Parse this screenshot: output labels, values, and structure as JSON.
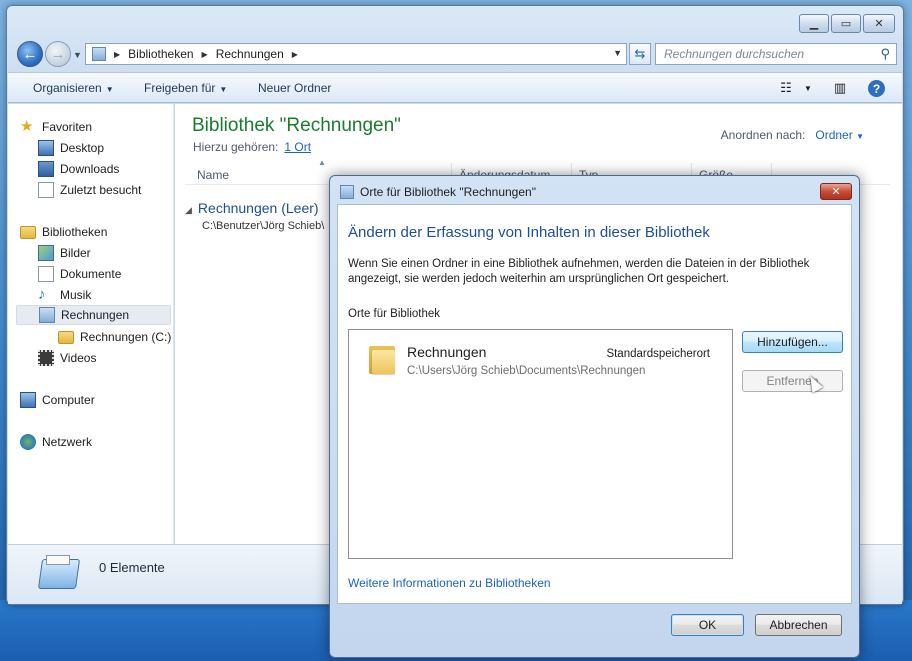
{
  "window": {
    "address": {
      "crumbs": [
        "Bibliotheken",
        "Rechnungen"
      ]
    },
    "search": {
      "placeholder": "Rechnungen durchsuchen"
    },
    "toolbar": {
      "organize": "Organisieren",
      "share": "Freigeben für",
      "new_folder": "Neuer Ordner"
    },
    "sidebar": {
      "favorites": {
        "label": "Favoriten",
        "items": [
          "Desktop",
          "Downloads",
          "Zuletzt besucht"
        ]
      },
      "libraries": {
        "label": "Bibliotheken",
        "items": [
          "Bilder",
          "Dokumente",
          "Musik",
          "Rechnungen",
          "Rechnungen (C:)",
          "Videos"
        ]
      },
      "computer": "Computer",
      "network": "Netzwerk"
    },
    "content": {
      "title": "Bibliothek \"Rechnungen\"",
      "includes_label": "Hierzu gehören:",
      "includes_link": "1 Ort",
      "arrange_label": "Anordnen nach:",
      "arrange_value": "Ordner",
      "columns": [
        "Name",
        "Änderungsdatum",
        "Typ",
        "Größe"
      ],
      "group_title": "Rechnungen (Leer)",
      "group_path": "C:\\Benutzer\\Jörg Schieb\\"
    },
    "details": {
      "count": "0 Elemente"
    }
  },
  "dialog": {
    "title": "Orte für Bibliothek \"Rechnungen\"",
    "heading": "Ändern der Erfassung von Inhalten in dieser Bibliothek",
    "description": "Wenn Sie einen Ordner in eine Bibliothek aufnehmen, werden die Dateien in der Bibliothek angezeigt, sie werden jedoch weiterhin am ursprünglichen Ort gespeichert.",
    "list_label": "Orte für Bibliothek",
    "locations": [
      {
        "name": "Rechnungen",
        "path": "C:\\Users\\Jörg Schieb\\Documents\\Rechnungen",
        "flag": "Standardspeicherort"
      }
    ],
    "add_button": "Hinzufügen...",
    "remove_button": "Entfernen",
    "more_info_link": "Weitere Informationen zu Bibliotheken",
    "ok_button": "OK",
    "cancel_button": "Abbrechen"
  }
}
